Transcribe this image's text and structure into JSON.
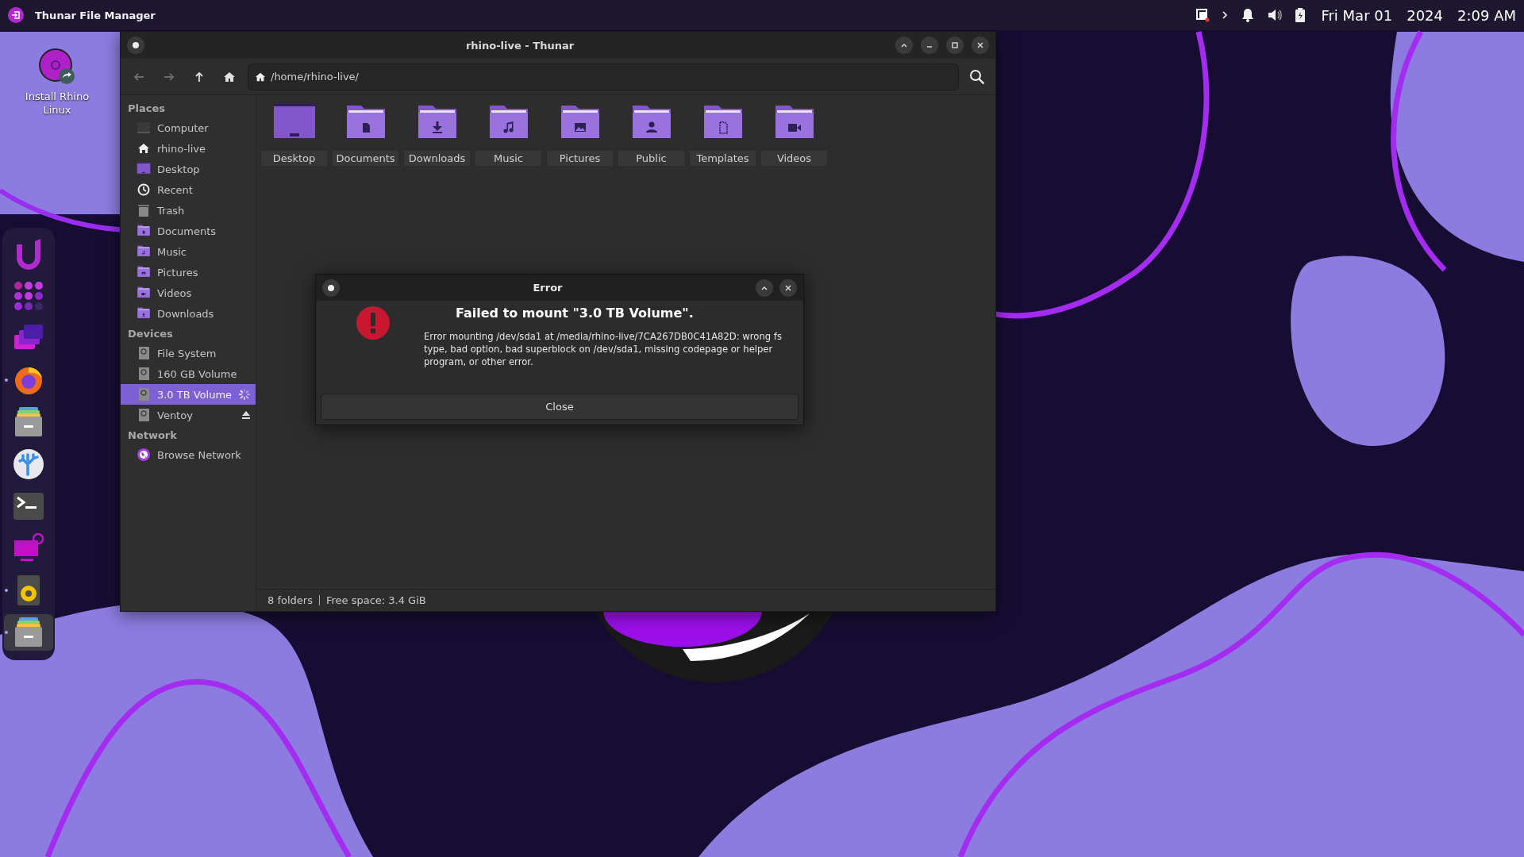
{
  "top_panel": {
    "app_title": "Thunar File Manager",
    "date": "Fri Mar 01",
    "year": "2024",
    "time": "2:09 AM"
  },
  "desktop_icons": [
    {
      "label": "Install Rhino Linux"
    }
  ],
  "dock": [
    {
      "kind": "launcher",
      "running": false,
      "selected": false
    },
    {
      "kind": "apps",
      "running": false,
      "selected": false
    },
    {
      "kind": "workspaces",
      "running": false,
      "selected": false
    },
    {
      "kind": "browser",
      "running": true,
      "selected": false
    },
    {
      "kind": "files",
      "running": false,
      "selected": false
    },
    {
      "kind": "store",
      "running": false,
      "selected": false
    },
    {
      "kind": "terminal",
      "running": false,
      "selected": false
    },
    {
      "kind": "display",
      "running": false,
      "selected": false
    },
    {
      "kind": "speaker",
      "running": true,
      "selected": false
    },
    {
      "kind": "files",
      "running": true,
      "selected": true
    }
  ],
  "window": {
    "title": "rhino-live - Thunar",
    "nav": [
      {
        "kind": "back",
        "disabled": true
      },
      {
        "kind": "forward",
        "disabled": true
      },
      {
        "kind": "up",
        "disabled": false
      },
      {
        "kind": "home",
        "disabled": false
      }
    ],
    "path": "/home/rhino-live/",
    "sidebar": [
      {
        "title": "Places",
        "items": [
          {
            "label": "Computer",
            "kind": "computer",
            "selected": false
          },
          {
            "label": "rhino-live",
            "kind": "home",
            "selected": false
          },
          {
            "label": "Desktop",
            "kind": "desktop",
            "selected": false
          },
          {
            "label": "Recent",
            "kind": "recent",
            "selected": false
          },
          {
            "label": "Trash",
            "kind": "trash",
            "selected": false
          },
          {
            "label": "Documents",
            "kind": "documents",
            "selected": false
          },
          {
            "label": "Music",
            "kind": "music",
            "selected": false
          },
          {
            "label": "Pictures",
            "kind": "pictures",
            "selected": false
          },
          {
            "label": "Videos",
            "kind": "videos",
            "selected": false
          },
          {
            "label": "Downloads",
            "kind": "downloads",
            "selected": false
          }
        ]
      },
      {
        "title": "Devices",
        "items": [
          {
            "label": "File System",
            "kind": "drive",
            "selected": false,
            "busy": false,
            "ejectable": false
          },
          {
            "label": "160 GB Volume",
            "kind": "drive",
            "selected": false,
            "busy": false,
            "ejectable": false
          },
          {
            "label": "3.0 TB Volume",
            "kind": "drive",
            "selected": true,
            "busy": true,
            "ejectable": false
          },
          {
            "label": "Ventoy",
            "kind": "drive",
            "selected": false,
            "busy": false,
            "ejectable": true
          }
        ]
      },
      {
        "title": "Network",
        "items": [
          {
            "label": "Browse Network",
            "kind": "network",
            "selected": false
          }
        ]
      }
    ],
    "folders": [
      {
        "name": "Desktop",
        "kind": "desktop"
      },
      {
        "name": "Documents",
        "kind": "documents"
      },
      {
        "name": "Downloads",
        "kind": "downloads"
      },
      {
        "name": "Music",
        "kind": "music"
      },
      {
        "name": "Pictures",
        "kind": "pictures"
      },
      {
        "name": "Public",
        "kind": "public"
      },
      {
        "name": "Templates",
        "kind": "templates"
      },
      {
        "name": "Videos",
        "kind": "videos"
      }
    ],
    "status_bar": {
      "count": "8 folders",
      "free_space": "Free space: 3.4 GiB"
    }
  },
  "dialog": {
    "title": "Error",
    "heading": "Failed to mount \"3.0 TB Volume\".",
    "message": "Error mounting /dev/sda1 at /media/rhino-live/7CA267DB0C41A82D: wrong fs type, bad option, bad superblock on /dev/sda1, missing codepage or helper program, or other error.",
    "button": "Close"
  }
}
